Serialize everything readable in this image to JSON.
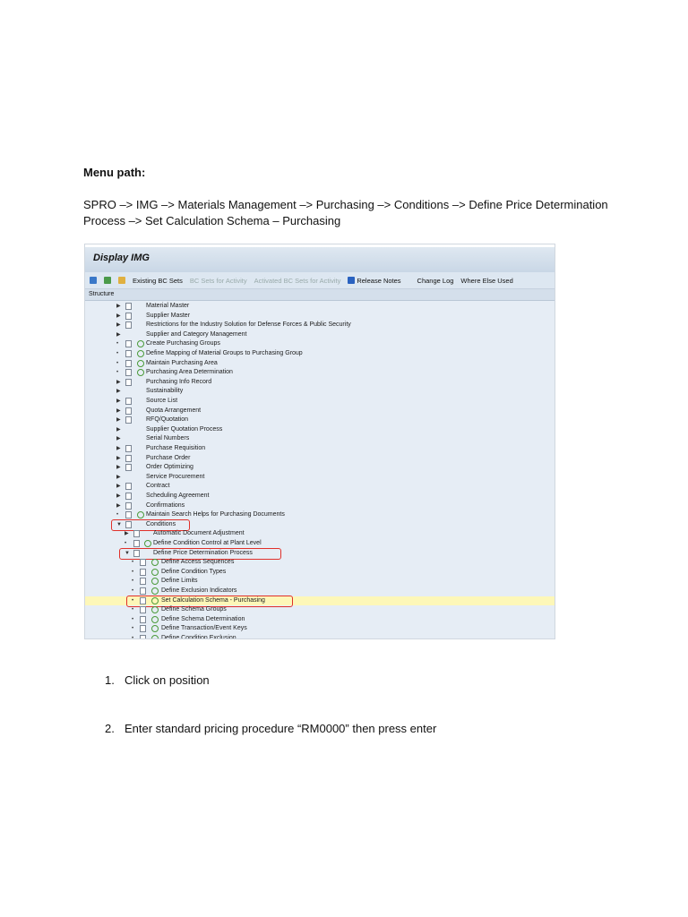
{
  "heading": "Menu path:",
  "path_text": "SPRO –> IMG –> Materials Management –> Purchasing –> Conditions –> Define Price Determination Process  –> Set Calculation Schema – Purchasing",
  "screenshot": {
    "title": "Display IMG",
    "toolbar": {
      "existing": "Existing BC Sets",
      "bc_activity": "BC Sets for Activity",
      "activated": "Activated BC Sets for Activity",
      "release": "Release Notes",
      "changelog": "Change Log",
      "where": "Where Else Used"
    },
    "structure_label": "Structure",
    "tree": [
      {
        "label": "Material Master",
        "lvl": 1,
        "mk": "arrow",
        "doc": true,
        "clock": false
      },
      {
        "label": "Supplier Master",
        "lvl": 1,
        "mk": "arrow",
        "doc": true,
        "clock": false
      },
      {
        "label": "Restrictions for the Industry Solution for Defense Forces & Public Security",
        "lvl": 1,
        "mk": "arrow",
        "doc": true,
        "clock": false
      },
      {
        "label": "Supplier and Category Management",
        "lvl": 1,
        "mk": "arrow",
        "doc": false,
        "clock": false
      },
      {
        "label": "Create Purchasing Groups",
        "lvl": 1,
        "mk": "bullet",
        "doc": true,
        "clock": true
      },
      {
        "label": "Define Mapping of Material Groups to Purchasing Group",
        "lvl": 1,
        "mk": "bullet",
        "doc": true,
        "clock": true
      },
      {
        "label": "Maintain Purchasing Area",
        "lvl": 1,
        "mk": "bullet",
        "doc": true,
        "clock": true
      },
      {
        "label": "Purchasing Area Determination",
        "lvl": 1,
        "mk": "bullet",
        "doc": true,
        "clock": true
      },
      {
        "label": "Purchasing Info Record",
        "lvl": 1,
        "mk": "arrow",
        "doc": true,
        "clock": false
      },
      {
        "label": "Sustainability",
        "lvl": 1,
        "mk": "arrow",
        "doc": false,
        "clock": false
      },
      {
        "label": "Source List",
        "lvl": 1,
        "mk": "arrow",
        "doc": true,
        "clock": false
      },
      {
        "label": "Quota Arrangement",
        "lvl": 1,
        "mk": "arrow",
        "doc": true,
        "clock": false
      },
      {
        "label": "RFQ/Quotation",
        "lvl": 1,
        "mk": "arrow",
        "doc": true,
        "clock": false
      },
      {
        "label": "Supplier Quotation Process",
        "lvl": 1,
        "mk": "arrow",
        "doc": false,
        "clock": false
      },
      {
        "label": "Serial Numbers",
        "lvl": 1,
        "mk": "arrow",
        "doc": false,
        "clock": false
      },
      {
        "label": "Purchase Requisition",
        "lvl": 1,
        "mk": "arrow",
        "doc": true,
        "clock": false
      },
      {
        "label": "Purchase Order",
        "lvl": 1,
        "mk": "arrow",
        "doc": true,
        "clock": false
      },
      {
        "label": "Order Optimizing",
        "lvl": 1,
        "mk": "arrow",
        "doc": true,
        "clock": false
      },
      {
        "label": "Service Procurement",
        "lvl": 1,
        "mk": "arrow",
        "doc": false,
        "clock": false
      },
      {
        "label": "Contract",
        "lvl": 1,
        "mk": "arrow",
        "doc": true,
        "clock": false
      },
      {
        "label": "Scheduling Agreement",
        "lvl": 1,
        "mk": "arrow",
        "doc": true,
        "clock": false
      },
      {
        "label": "Confirmations",
        "lvl": 1,
        "mk": "arrow",
        "doc": true,
        "clock": false
      },
      {
        "label": "Maintain Search Helps for Purchasing Documents",
        "lvl": 1,
        "mk": "bullet",
        "doc": true,
        "clock": true
      },
      {
        "label": "Conditions",
        "lvl": 1,
        "mk": "open",
        "doc": true,
        "clock": false,
        "boxed": true
      },
      {
        "label": "Automatic Document Adjustment",
        "lvl": 2,
        "mk": "arrow",
        "doc": true,
        "clock": false
      },
      {
        "label": "Define Condition Control at Plant Level",
        "lvl": 2,
        "mk": "bullet",
        "doc": true,
        "clock": true
      },
      {
        "label": "Define Price Determination Process",
        "lvl": 2,
        "mk": "open",
        "doc": true,
        "clock": false,
        "boxed": true
      },
      {
        "label": "Define Access Sequences",
        "lvl": 3,
        "mk": "bullet",
        "doc": true,
        "clock": true
      },
      {
        "label": "Define Condition Types",
        "lvl": 3,
        "mk": "bullet",
        "doc": true,
        "clock": true
      },
      {
        "label": "Define Limits",
        "lvl": 3,
        "mk": "bullet",
        "doc": true,
        "clock": true
      },
      {
        "label": "Define Exclusion Indicators",
        "lvl": 3,
        "mk": "bullet",
        "doc": true,
        "clock": true
      },
      {
        "label": "Set Calculation Schema - Purchasing",
        "lvl": 3,
        "mk": "bullet",
        "doc": true,
        "clock": true,
        "boxed": true,
        "selected": true
      },
      {
        "label": "Define Schema Groups",
        "lvl": 3,
        "mk": "bullet",
        "doc": true,
        "clock": true
      },
      {
        "label": "Define Schema Determination",
        "lvl": 3,
        "mk": "bullet",
        "doc": true,
        "clock": true
      },
      {
        "label": "Define Transaction/Event Keys",
        "lvl": 3,
        "mk": "bullet",
        "doc": true,
        "clock": true
      },
      {
        "label": "Define Condition Exclusion",
        "lvl": 3,
        "mk": "bullet",
        "doc": true,
        "clock": true
      }
    ]
  },
  "steps": [
    {
      "num": "1.",
      "text": "Click on position"
    },
    {
      "num": "2.",
      "text": "Enter standard pricing procedure “RM0000” then press enter"
    }
  ]
}
